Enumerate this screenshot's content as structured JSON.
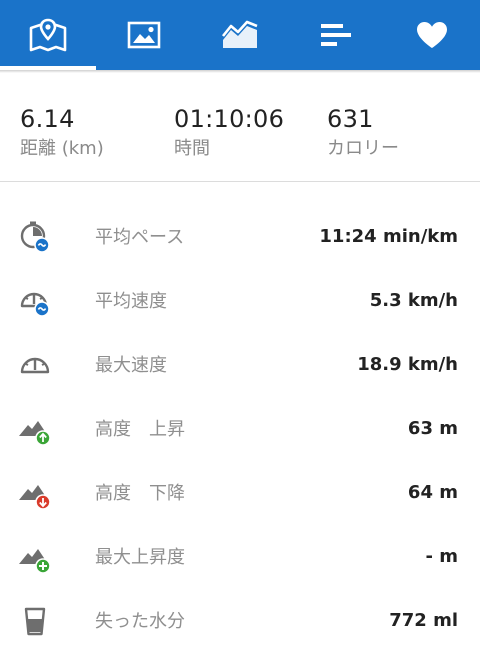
{
  "tabs": [
    {
      "icon": "map-icon",
      "active": true
    },
    {
      "icon": "image-icon",
      "active": false
    },
    {
      "icon": "chart-icon",
      "active": false
    },
    {
      "icon": "bars-icon",
      "active": false
    },
    {
      "icon": "heart-icon",
      "active": false
    }
  ],
  "colors": {
    "accent": "#1a73c9",
    "icon_gray": "#6e6e6e",
    "badge_blue": "#1a73c9",
    "badge_green": "#3aa537",
    "badge_red": "#d93b2b"
  },
  "summary": {
    "distance": {
      "value": "6.14",
      "label": "距離 (km)"
    },
    "time": {
      "value": "01:10:06",
      "label": "時間"
    },
    "calories": {
      "value": "631",
      "label": "カロリー"
    }
  },
  "rows": [
    {
      "icon": "stopwatch-pace-icon",
      "label": "平均ペース",
      "value": "11:24 min/km"
    },
    {
      "icon": "speedometer-average-icon",
      "label": "平均速度",
      "value": "5.3 km/h"
    },
    {
      "icon": "speedometer-icon",
      "label": "最大速度",
      "value": "18.9 km/h"
    },
    {
      "icon": "mountain-ascent-icon",
      "label": "高度　上昇",
      "value": "63 m"
    },
    {
      "icon": "mountain-descent-icon",
      "label": "高度　下降",
      "value": "64 m"
    },
    {
      "icon": "mountain-max-icon",
      "label": "最大上昇度",
      "value": "- m"
    },
    {
      "icon": "water-glass-icon",
      "label": "失った水分",
      "value": "772 ml"
    }
  ]
}
